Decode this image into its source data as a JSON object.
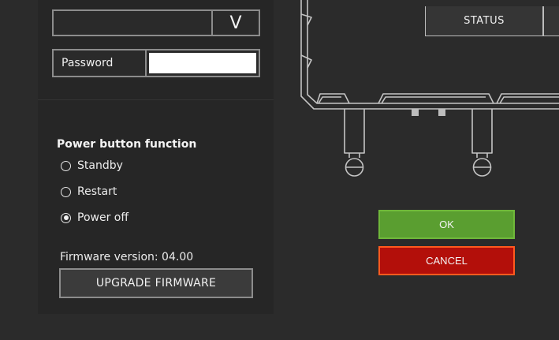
{
  "auth": {
    "dropdown_arrow": "V",
    "password_label": "Password",
    "password_value": ""
  },
  "power_button": {
    "title": "Power button function",
    "options": [
      {
        "label": "Standby",
        "selected": false
      },
      {
        "label": "Restart",
        "selected": false
      },
      {
        "label": "Power off",
        "selected": true
      }
    ]
  },
  "firmware": {
    "version_text": "Firmware version: 04.00",
    "upgrade_label": "UPGRADE FIRMWARE"
  },
  "device_diagram": {
    "status_label": "STATUS"
  },
  "dialog": {
    "ok_label": "OK",
    "cancel_label": "CANCEL"
  },
  "colors": {
    "background": "#2b2b2b",
    "panel": "#262626",
    "ok": "#5a9e30",
    "cancel": "#b30f0a",
    "cancel_border": "#ff5a1f"
  }
}
